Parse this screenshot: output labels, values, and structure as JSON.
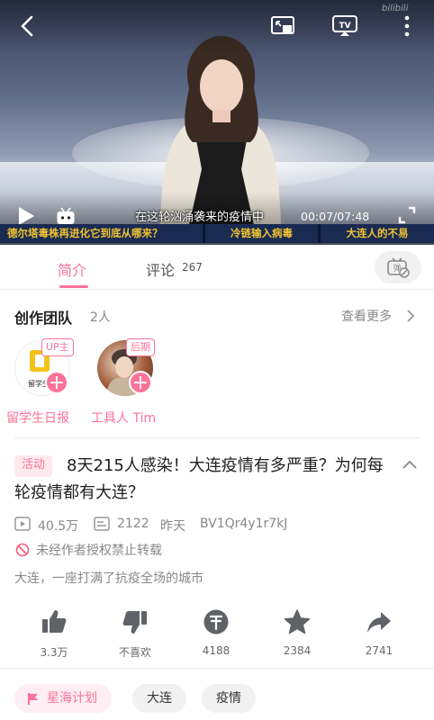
{
  "video": {
    "subtitle": "在这轮汹涌袭来的疫情中",
    "time": "00:07/07:48",
    "watermark": "bilibili",
    "ticker": [
      "德尔塔毒株再进化它到底从哪来？",
      "冷链输入病毒",
      "大连人的不易"
    ]
  },
  "tabs": {
    "intro": "简介",
    "comment": "评论",
    "comment_count": "267"
  },
  "team": {
    "title": "创作团队",
    "count": "2人",
    "see_more": "查看更多",
    "members": [
      {
        "role": "UP主",
        "name": "留学生日报",
        "logo_text": "留学生"
      },
      {
        "role": "后期",
        "name": "工具人 Tim"
      }
    ]
  },
  "video_info": {
    "tag": "活动",
    "title": "8天215人感染！大连疫情有多严重？为何每轮疫情都有大连？",
    "views": "40.5万",
    "danmaku": "2122",
    "date": "昨天",
    "bvid": "BV1Qr4y1r7kJ",
    "notice": "未经作者授权禁止转载",
    "description": "大连，一座打满了抗疫全场的城市"
  },
  "actions": [
    {
      "icon": "like-icon",
      "label": "3.3万"
    },
    {
      "icon": "dislike-icon",
      "label": "不喜欢"
    },
    {
      "icon": "coin-icon",
      "label": "4188"
    },
    {
      "icon": "star-icon",
      "label": "2384"
    },
    {
      "icon": "share-icon",
      "label": "2741"
    }
  ],
  "tags": [
    "星海计划",
    "大连",
    "疫情"
  ],
  "colors": {
    "accent": "#fb7299",
    "icon_gray": "#5f6266",
    "ticker_bg": "#1a2b52",
    "ticker_text": "#f1c232"
  }
}
